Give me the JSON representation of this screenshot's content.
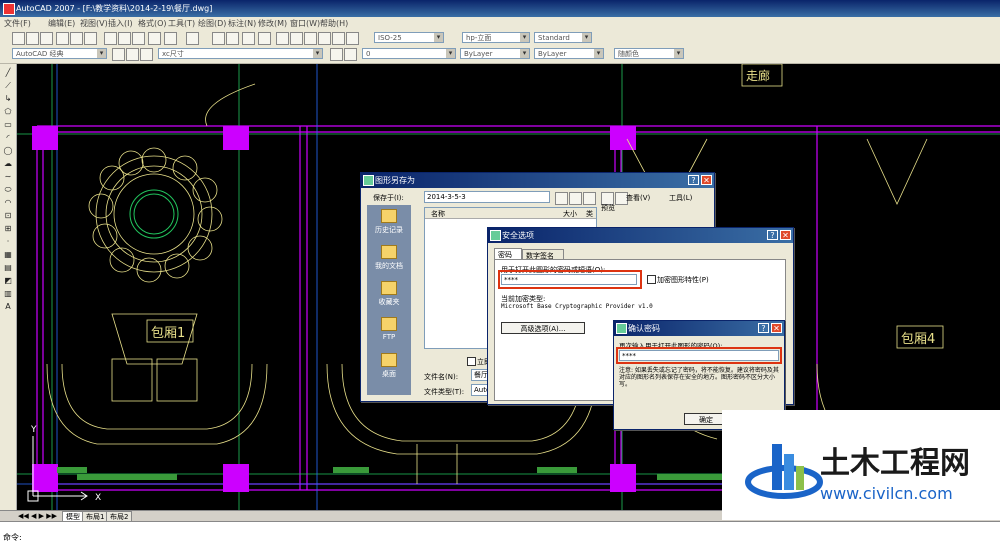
{
  "window": {
    "title": "AutoCAD 2007 - [F:\\教学资料\\2014-2-19\\餐厅.dwg]"
  },
  "menu": [
    "文件(F)",
    "编辑(E)",
    "视图(V)",
    "插入(I)",
    "格式(O)",
    "工具(T)",
    "绘图(D)",
    "标注(N)",
    "修改(M)",
    "窗口(W)",
    "帮助(H)"
  ],
  "toolbar2": {
    "workspace": "AutoCAD 经典",
    "style_combo": "ISO-25",
    "dimstyle_combo": "xc尺寸",
    "plot_combo": "Standard",
    "textstyle_combo": "hp-立面",
    "linetype_combo": "ByLayer",
    "layer_combo": "0",
    "lineweight_combo": "ByLayer",
    "color_combo": "随颜色"
  },
  "drawing": {
    "rooms": [
      "包厢1",
      "包厢4"
    ],
    "corridor": "走廊",
    "axis_x": "X",
    "axis_y": "Y"
  },
  "layout_tabs": [
    "模型",
    "布局1",
    "布局2"
  ],
  "command": {
    "prompt": "命令:"
  },
  "save_dialog": {
    "title": "图形另存为",
    "save_in_label": "保存于(I):",
    "save_in_value": "2014-3-5-3",
    "places": [
      "历史记录",
      "我的文档",
      "收藏夹",
      "FTP",
      "桌面"
    ],
    "col_name": "名称",
    "col_size": "大小",
    "col_type": "类",
    "preview": "预览",
    "view_menu": "查看(V)",
    "tools_menu": "工具(L)",
    "filename_label": "文件名(N):",
    "filename_value": "餐厅",
    "filetype_label": "文件类型(T):",
    "filetype_value": "AutoCAD",
    "open_label": "立即"
  },
  "security_dialog": {
    "title": "安全选项",
    "tabs": [
      "密码",
      "数字签名"
    ],
    "password_prompt": "用于打开此图形的密码或短语(O):",
    "password_value": "****",
    "encrypt_props": "加密图形特性(P)",
    "encryption_type_label": "当前加密类型:",
    "encryption_type_value": "Microsoft Base Cryptographic Provider v1.0",
    "advanced_button": "高级选项(A)..."
  },
  "confirm_dialog": {
    "title": "确认密码",
    "prompt": "再次输入用于打开此图形的密码(O):",
    "password_value": "****",
    "warning": "注意: 如果丢失或忘记了密码，将不能恢复。建议将密码及其对应的图形名列表保存在安全的地方。图形密码不区分大小写。",
    "ok_button": "确定"
  },
  "watermark": {
    "cn": "土木工程网",
    "url": "www.civilcn.com"
  },
  "colors": {
    "magenta": "#cc00ff",
    "yellow": "#e8e08a",
    "green": "#22c55e",
    "blue_wm": "#1a64c8"
  }
}
